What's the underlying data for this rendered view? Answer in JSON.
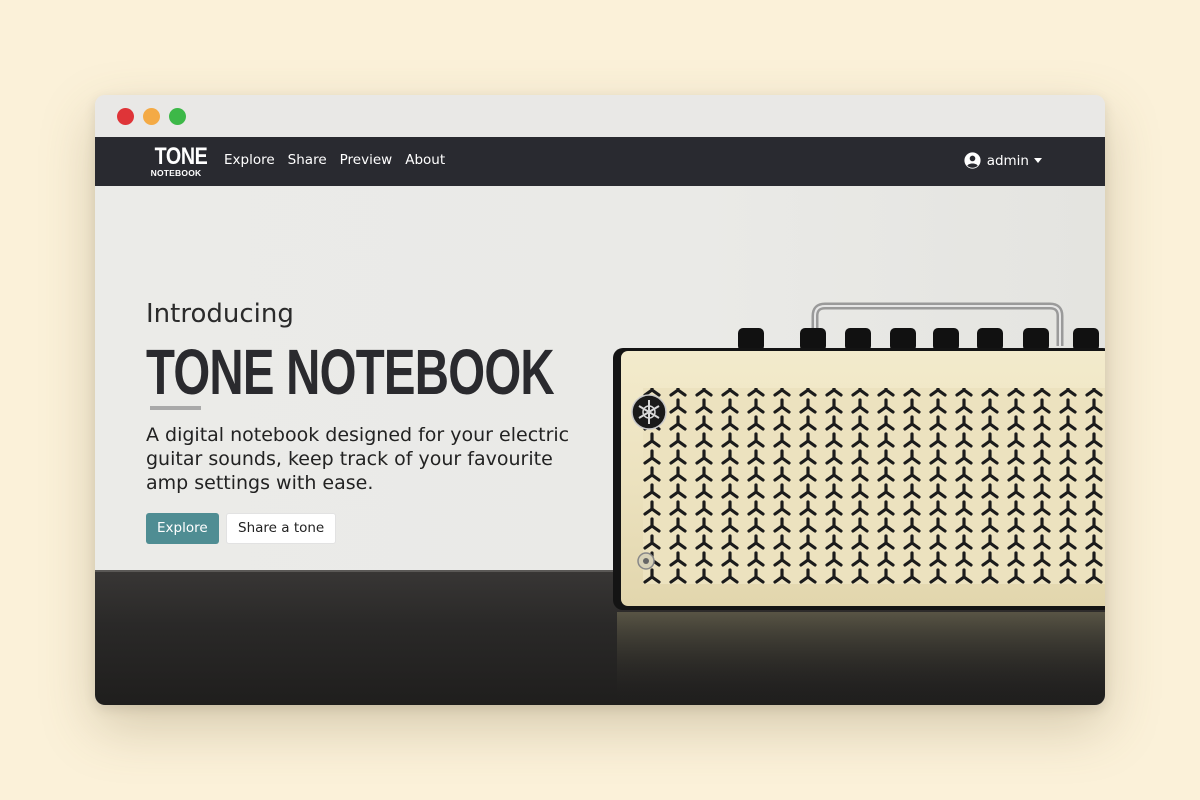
{
  "nav": {
    "logo_big": "TONE",
    "logo_small": "NOTEBOOK",
    "links": [
      "Explore",
      "Share",
      "Preview",
      "About"
    ],
    "user": "admin"
  },
  "hero": {
    "intro": "Introducing",
    "headline": "TONE NOTEBOOK",
    "description": "A digital notebook designed for your electric guitar sounds, keep track of your favourite amp settings with ease.",
    "explore_button": "Explore",
    "share_button": "Share a tone"
  },
  "colors": {
    "navbar": "#292a30",
    "accent": "#4f8d93",
    "background": "#fbf1d9"
  },
  "icons": [
    "user-circle-icon",
    "caret-down-icon",
    "yamaha-logo-icon"
  ]
}
